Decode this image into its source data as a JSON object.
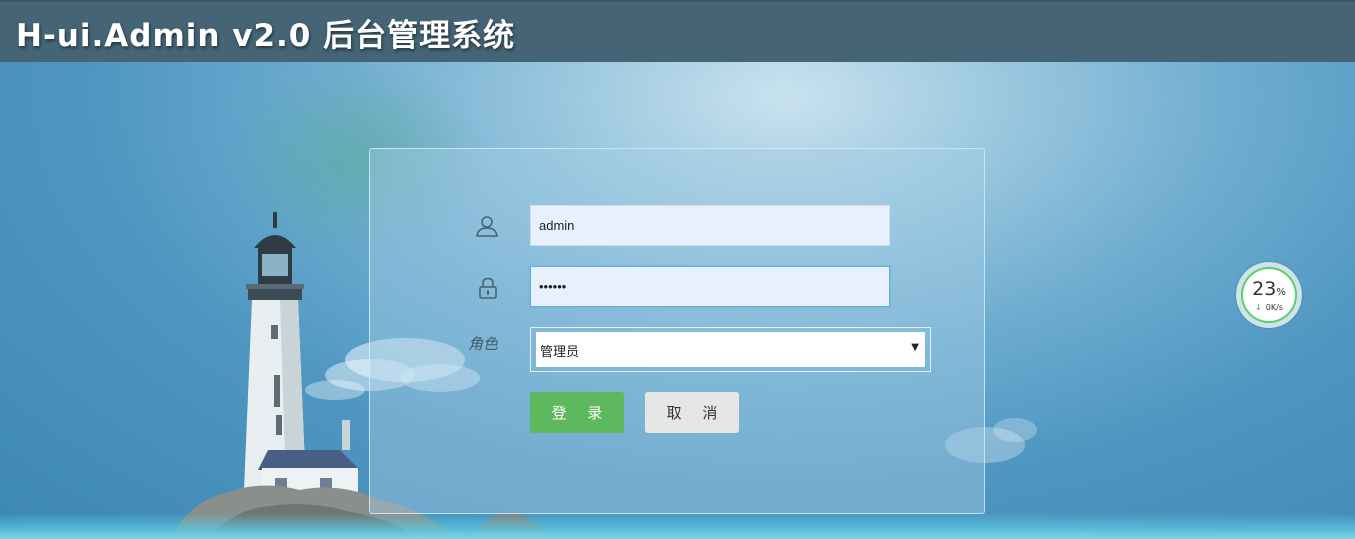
{
  "header": {
    "title": "H-ui.Admin v2.0 后台管理系统"
  },
  "login": {
    "username_value": "admin",
    "password_value": "••••••",
    "role_label": "角色",
    "role_selected": "管理员",
    "login_button": "登 录",
    "cancel_button": "取 消"
  },
  "speed_widget": {
    "percent": "23",
    "percent_unit": "%",
    "rate": "0K/s"
  },
  "colors": {
    "header_bg": "#456577",
    "login_button": "#5eb95e",
    "cancel_button": "#e6e6e6",
    "speed_ring": "#58d06b"
  },
  "icons": {
    "username": "user-icon",
    "password": "lock-icon",
    "select_arrow": "caret-down-icon",
    "download": "arrow-down-icon"
  }
}
